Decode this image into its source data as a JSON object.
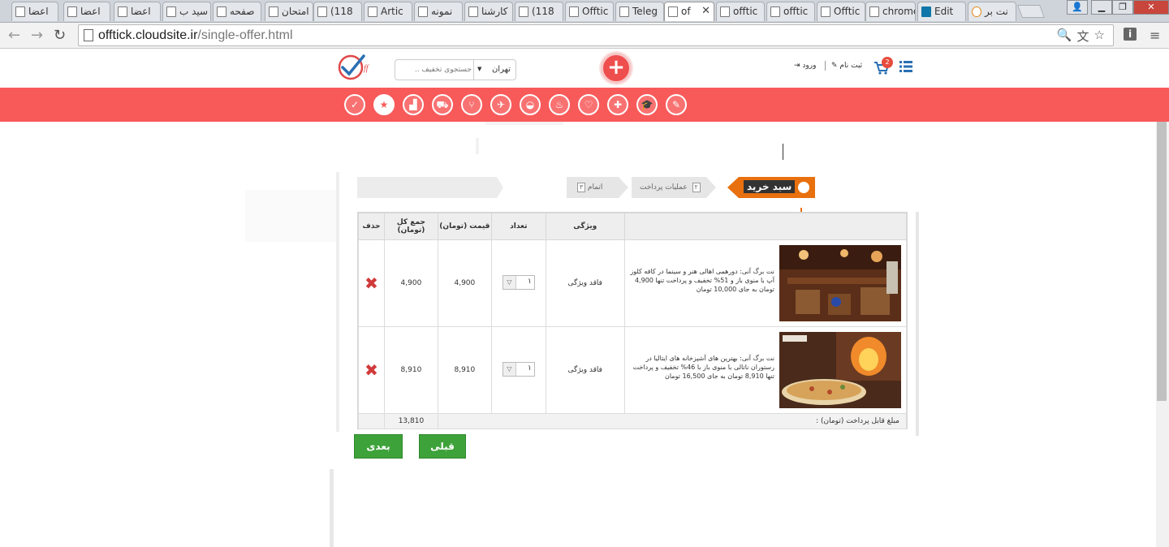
{
  "browser": {
    "tabs": [
      {
        "label": "اعضا"
      },
      {
        "label": "اعضا"
      },
      {
        "label": "اعضا"
      },
      {
        "label": "سید ب"
      },
      {
        "label": "صفحه"
      },
      {
        "label": "امتحان"
      },
      {
        "label": "(118"
      },
      {
        "label": "Artic"
      },
      {
        "label": "نمونه"
      },
      {
        "label": "کارشنا"
      },
      {
        "label": "(118"
      },
      {
        "label": "Offtic"
      },
      {
        "label": "Teleg"
      },
      {
        "label": "of"
      },
      {
        "label": "offtic"
      },
      {
        "label": "offtic"
      },
      {
        "label": "Offtic"
      },
      {
        "label": "chrome-"
      },
      {
        "label": "Edit"
      },
      {
        "label": "نت بر"
      }
    ],
    "url_domain": "offtick.cloudsite.ir",
    "url_path": "/single-offer.html"
  },
  "header": {
    "search_placeholder": "جستجوی تخفیف ..",
    "city": "تهران",
    "signup": "ثبت نام",
    "login": "ورود",
    "cart_count": "2",
    "plus": "+"
  },
  "steps": {
    "s1_label": "سبد خرید",
    "s2_label": "عملیات پرداخت",
    "s2_num": "۲",
    "s3_label": "اتمام",
    "s3_num": "۳"
  },
  "table": {
    "headers": {
      "product": "",
      "feature": "ویژگی",
      "qty": "تعداد",
      "price": "قیمت (تومان)",
      "total": "جمع کل (تومان)",
      "delete": "حذف"
    },
    "rows": [
      {
        "description": "نت برگ آنی: دورهمی اهالی هنر و سینما در کافه کلوز آپ با منوی باز و 51% تخفیف و پرداخت تنها 4,900 تومان به جای 10,000 تومان",
        "feature": "فاقد ویژگی",
        "qty": "۱",
        "price": "4,900",
        "total": "4,900"
      },
      {
        "description": "نت برگ آنی: بهترین های آشپزخانه های ایتالیا در رستوران ناتالی با منوی باز با 46% تخفیف و پرداخت تنها 8,910 تومان به جای 16,500 تومان",
        "feature": "فاقد ویژگی",
        "qty": "۱",
        "price": "8,910",
        "total": "8,910"
      }
    ],
    "total_label": "مبلغ قابل پرداخت (تومان) :",
    "total_value": "13,810"
  },
  "buttons": {
    "next": "بعدی",
    "prev": "قبلی"
  },
  "colors": {
    "brand_red": "#f85a5a",
    "step_orange": "#e8700e",
    "button_green": "#3ea23a",
    "delete_red": "#d13a3a"
  }
}
